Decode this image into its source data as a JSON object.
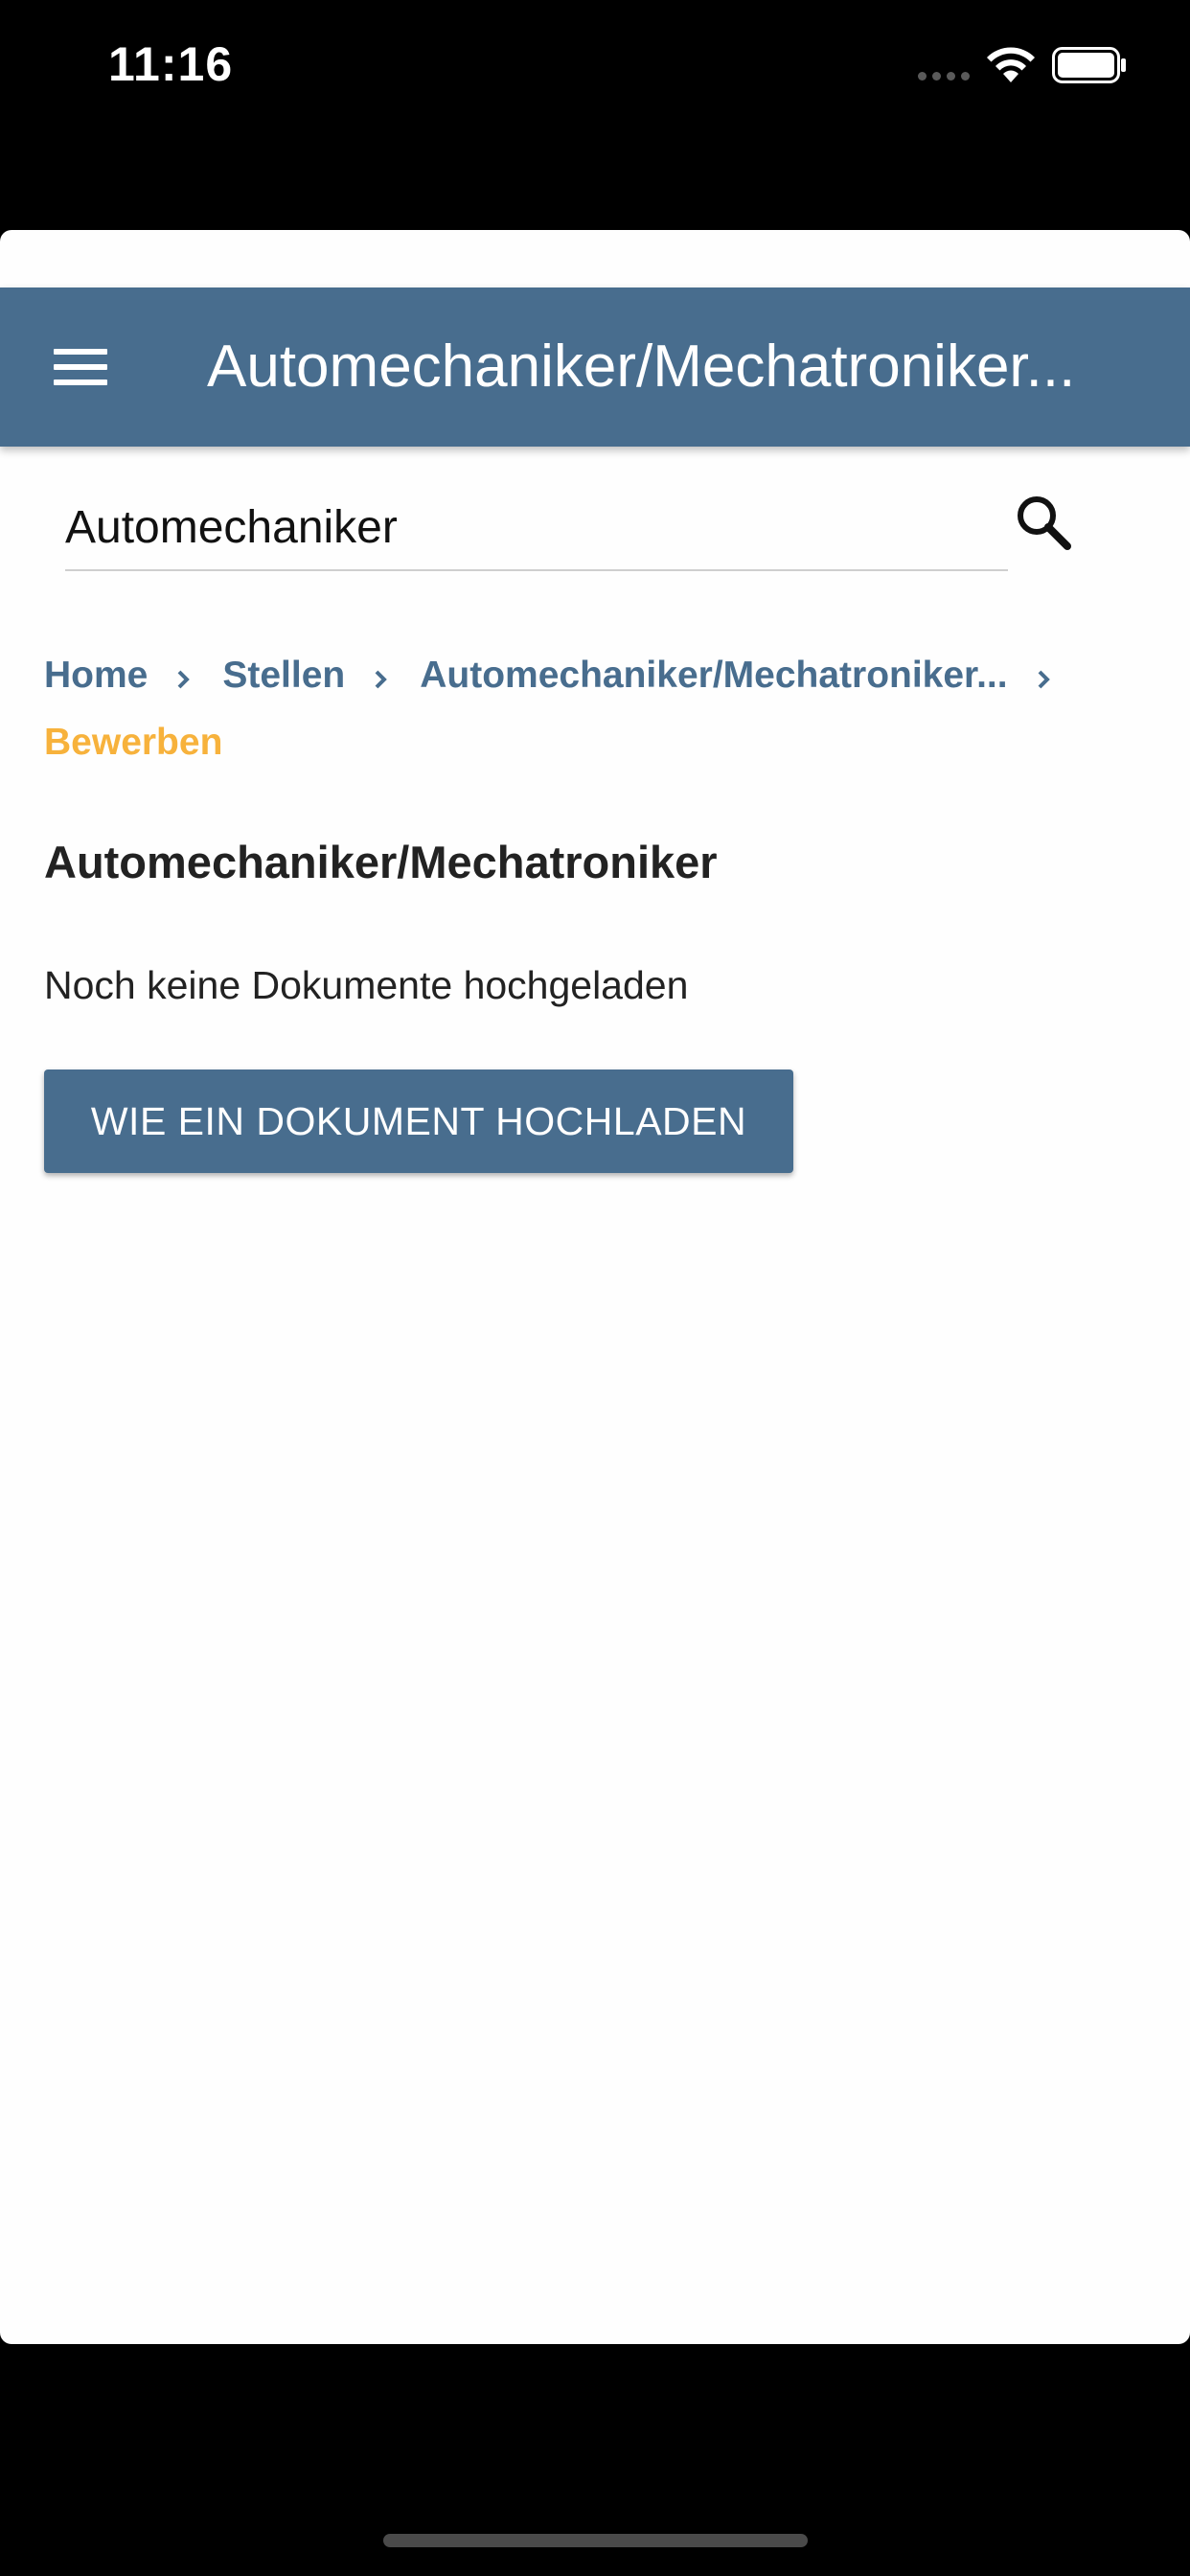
{
  "status_bar": {
    "time": "11:16"
  },
  "app_bar": {
    "title": "Automechaniker/Mechatroniker..."
  },
  "search": {
    "value": "Automechaniker",
    "placeholder": ""
  },
  "breadcrumb": {
    "items": [
      {
        "label": "Home"
      },
      {
        "label": "Stellen"
      },
      {
        "label": "Automechaniker/Mechatroniker..."
      }
    ],
    "current": "Bewerben"
  },
  "main": {
    "heading": "Automechaniker/Mechatroniker",
    "empty_message": "Noch keine Dokumente hochgeladen",
    "upload_button_label": "WIE EIN DOKUMENT HOCHLADEN"
  },
  "icons": {
    "menu": "menu-icon",
    "search": "search-icon",
    "breadcrumb_separator": "chevron-right-icon",
    "wifi": "wifi-icon",
    "battery": "battery-icon",
    "signal": "signal-icon"
  },
  "colors": {
    "primary": "#486d8e",
    "accent": "#f7b23c",
    "text": "#222222",
    "background": "#fefefe"
  }
}
